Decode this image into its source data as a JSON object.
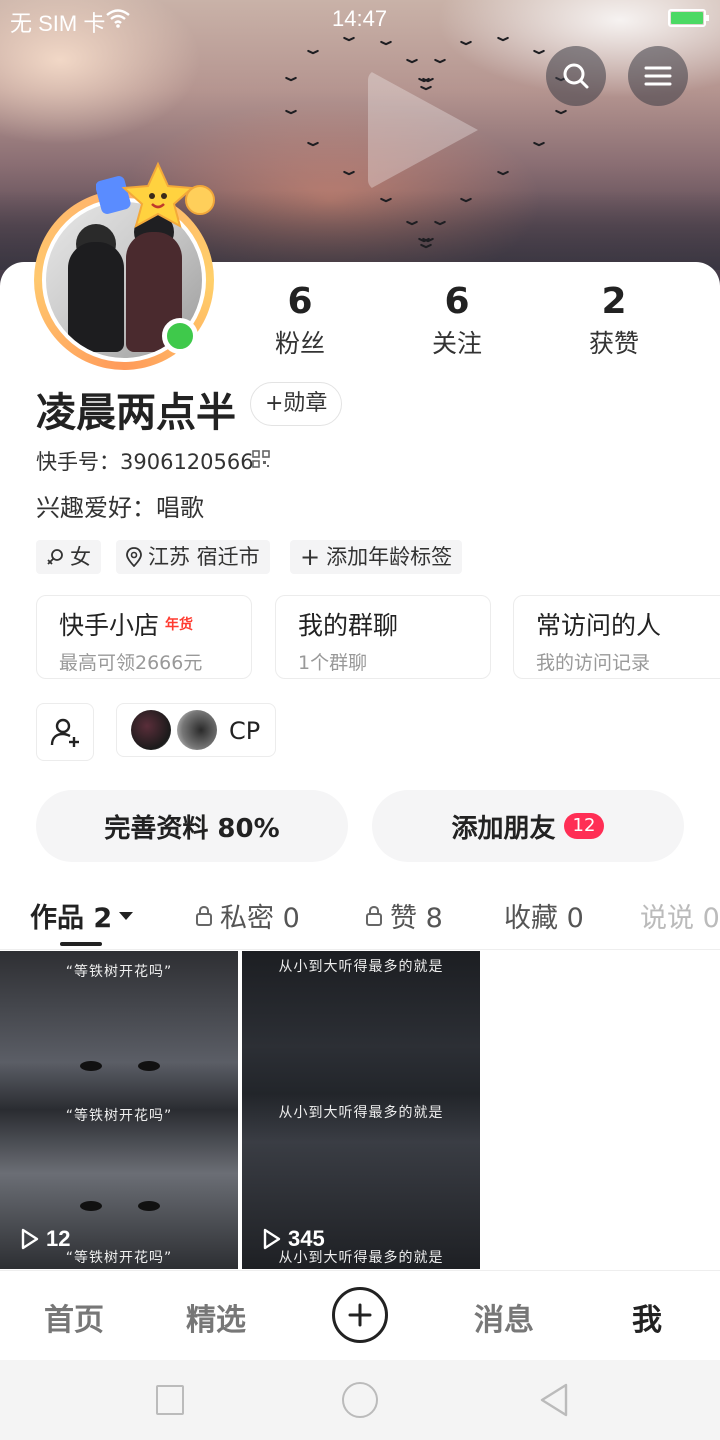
{
  "status_bar": {
    "carrier": "无 SIM 卡",
    "time": "14:47",
    "battery_color": "#4cd964"
  },
  "header": {
    "search_icon": "search-icon",
    "menu_icon": "menu-icon",
    "banner_play_icon": "play-icon"
  },
  "profile": {
    "nickname": "凌晨两点半",
    "badge_button": "+勋章",
    "kuaishou_id": "快手号：3906120566",
    "hobby": "兴趣爱好：唱歌",
    "online": true,
    "tags": {
      "gender": "女",
      "location": "江苏 宿迁市",
      "add_age": "添加年龄标签"
    }
  },
  "stats": {
    "fans": {
      "value": "6",
      "label": "粉丝"
    },
    "following": {
      "value": "6",
      "label": "关注"
    },
    "likes": {
      "value": "2",
      "label": "获赞"
    }
  },
  "features": [
    {
      "title": "快手小店",
      "hot": "年货",
      "sub": "最高可领2666元"
    },
    {
      "title": "我的群聊",
      "sub": "1个群聊"
    },
    {
      "title": "常访问的人",
      "sub": "我的访问记录"
    }
  ],
  "cp": {
    "label": "CP"
  },
  "actions": {
    "complete_profile": "完善资料 80%",
    "add_friends": "添加朋友",
    "friend_count": "12"
  },
  "tabs": {
    "works": "作品 2",
    "private": "私密 0",
    "liked": "赞 8",
    "collection": "收藏 0",
    "talk": "说说 0"
  },
  "works": [
    {
      "caption": "“等铁树开花吗”",
      "plays": "12"
    },
    {
      "caption": "从小到大听得最多的就是",
      "plays": "345"
    }
  ],
  "bottom_nav": {
    "home": "首页",
    "featured": "精选",
    "messages": "消息",
    "me": "我"
  },
  "accent": {
    "online_green": "#3fc94b",
    "badge_red": "#ff2e55",
    "hot_red": "#ff3b30"
  }
}
